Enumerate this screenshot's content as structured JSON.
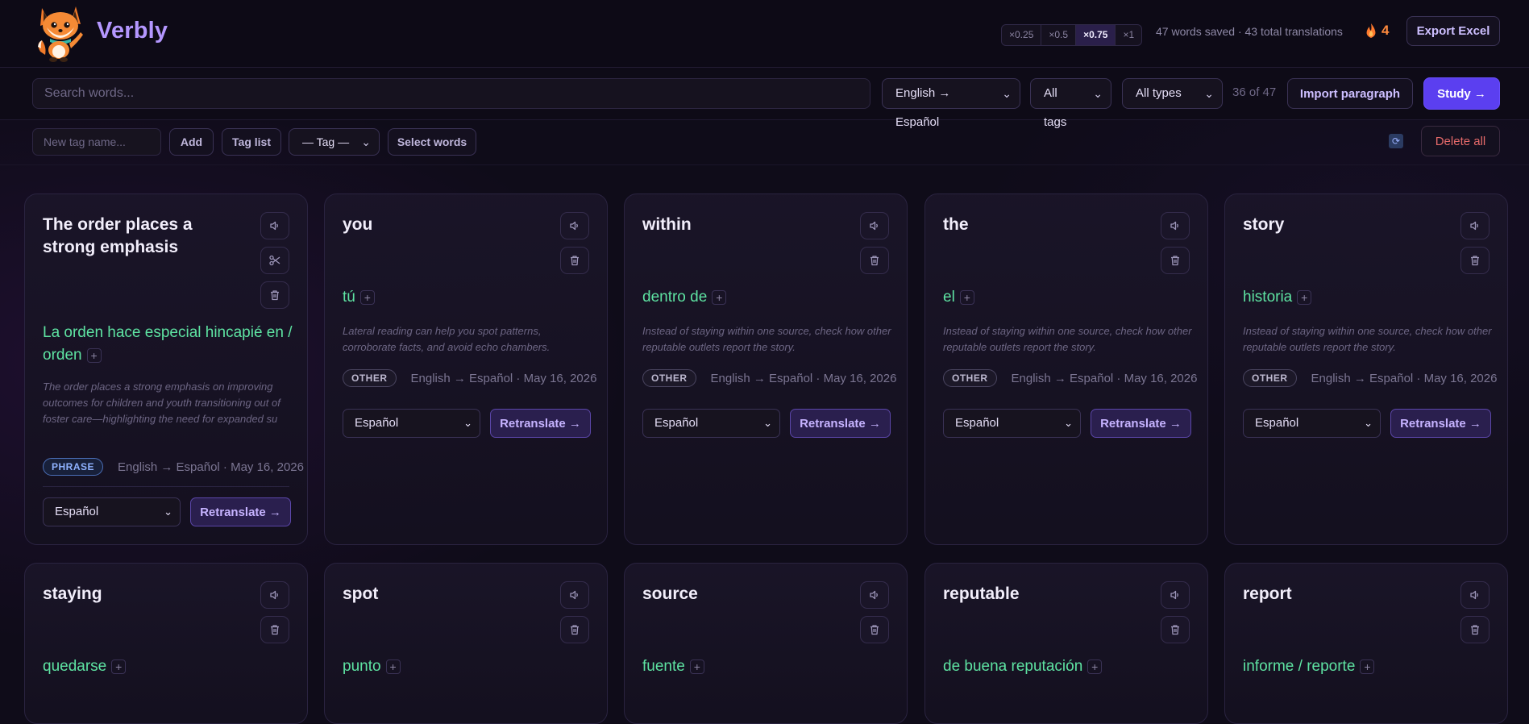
{
  "brand": {
    "name": "Verbly"
  },
  "speeds": [
    "×0.25",
    "×0.5",
    "×0.75",
    "×1"
  ],
  "active_speed": "×0.75",
  "stats": {
    "text": "47 words saved · 43 total translations"
  },
  "streak": {
    "count": "4"
  },
  "export_label": "Export Excel",
  "search": {
    "placeholder": "Search words..."
  },
  "filters": {
    "language": "English → Español",
    "tags": "All tags",
    "types": "All types"
  },
  "count": "36 of 47",
  "import_label": "Import paragraph",
  "study_label": "Study →",
  "tag_bar": {
    "placeholder": "New tag name...",
    "add": "Add",
    "tag_list": "Tag list",
    "tag_select": "— Tag —",
    "select_words": "Select words"
  },
  "delete_all": "Delete all",
  "card_defaults": {
    "target_lang": "Español",
    "retranslate": "Retranslate →"
  },
  "cards": [
    {
      "word": "The order places a strong emphasis",
      "translation": "La orden hace especial hincapié en / orden",
      "context": "The order places a strong emphasis on improving outcomes for children and youth transitioning out of foster care—highlighting the need for expanded su",
      "type": "PHRASE",
      "meta": "English → Español · May 16, 2026"
    },
    {
      "word": "you",
      "translation": "tú",
      "context": "Lateral reading can help you spot patterns, corroborate facts, and avoid echo chambers.",
      "type": "OTHER",
      "meta": "English → Español · May 16, 2026"
    },
    {
      "word": "within",
      "translation": "dentro de",
      "context": "Instead of staying within one source, check how other reputable outlets report the story.",
      "type": "OTHER",
      "meta": "English → Español · May 16, 2026"
    },
    {
      "word": "the",
      "translation": "el",
      "context": "Instead of staying within one source, check how other reputable outlets report the story.",
      "type": "OTHER",
      "meta": "English → Español · May 16, 2026"
    },
    {
      "word": "story",
      "translation": "historia",
      "context": "Instead of staying within one source, check how other reputable outlets report the story.",
      "type": "OTHER",
      "meta": "English → Español · May 16, 2026"
    },
    {
      "word": "staying",
      "translation": "quedarse"
    },
    {
      "word": "spot",
      "translation": "punto"
    },
    {
      "word": "source",
      "translation": "fuente"
    },
    {
      "word": "reputable",
      "translation": "de buena reputación"
    },
    {
      "word": "report",
      "translation": "informe / reporte"
    }
  ],
  "colors": {
    "accent": "#5b3ff0",
    "brand": "#b497ff",
    "translation": "#5ee3a2",
    "danger": "#e66a6a"
  }
}
